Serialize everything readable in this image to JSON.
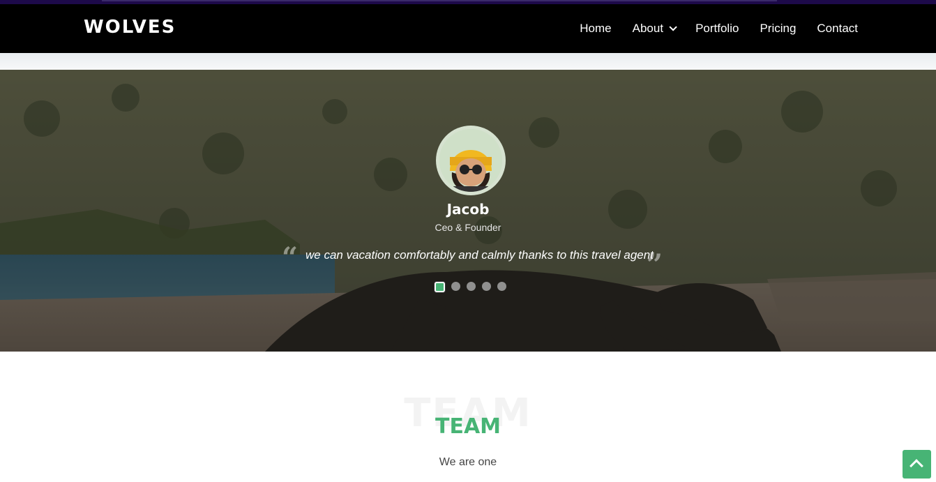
{
  "header": {
    "brand": "WOLVES",
    "nav": [
      {
        "label": "Home"
      },
      {
        "label": "About",
        "has_dropdown": true
      },
      {
        "label": "Portfolio"
      },
      {
        "label": "Pricing"
      },
      {
        "label": "Contact"
      }
    ]
  },
  "testimonial": {
    "name": "Jacob",
    "role": "Ceo & Founder",
    "quote": "we can vacation comfortably and calmly thanks to this travel agent",
    "slides_total": 5,
    "active_slide": 1
  },
  "team": {
    "background_word": "TEAM",
    "title": "TEAM",
    "subtitle": "We are one"
  },
  "icons": {
    "quote_open": "quote-open-icon",
    "quote_close": "quote-close-icon",
    "about_dropdown": "chevron-down-icon",
    "back_to_top": "arrow-up-icon"
  },
  "colors": {
    "accent": "#47b475",
    "navbar": "#000000",
    "top_strip": "#1d0a4a"
  }
}
